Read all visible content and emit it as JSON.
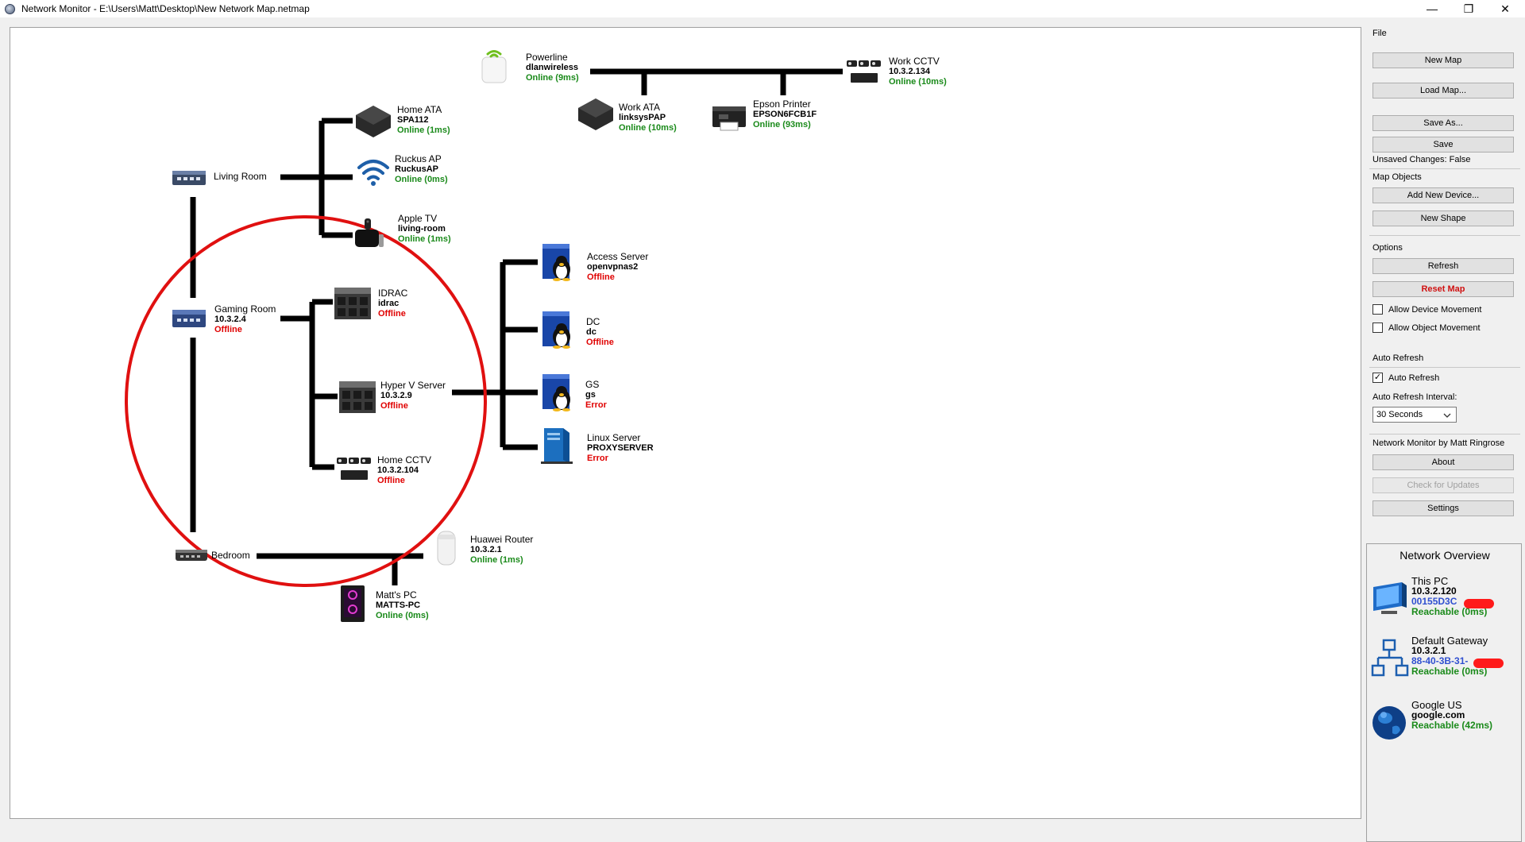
{
  "window": {
    "title": "Network Monitor - E:\\Users\\Matt\\Desktop\\New Network Map.netmap",
    "minimize": "—",
    "maximize": "❐",
    "close": "✕"
  },
  "devices": {
    "living_room": {
      "name": "Living Room",
      "icon": "switch-icon"
    },
    "gaming_room": {
      "name": "Gaming Room",
      "host": "10.3.2.4",
      "status": "Offline",
      "icon": "switch-icon"
    },
    "bedroom": {
      "name": "Bedroom",
      "icon": "switch-icon"
    },
    "home_ata": {
      "name": "Home ATA",
      "host": "SPA112",
      "status": "Online (1ms)",
      "icon": "ata-icon"
    },
    "ruckus_ap": {
      "name": "Ruckus AP",
      "host": "RuckusAP",
      "status": "Online (0ms)",
      "icon": "wifi-icon"
    },
    "apple_tv": {
      "name": "Apple TV",
      "host": "living-room",
      "status": "Online (1ms)",
      "icon": "apple-tv-icon"
    },
    "idrac": {
      "name": "IDRAC",
      "host": "idrac",
      "status": "Offline",
      "icon": "server-icon"
    },
    "hyperv": {
      "name": "Hyper V Server",
      "host": "10.3.2.9",
      "status": "Offline",
      "icon": "server-icon"
    },
    "home_cctv": {
      "name": "Home CCTV",
      "host": "10.3.2.104",
      "status": "Offline",
      "icon": "cctv-icon"
    },
    "access_server": {
      "name": "Access Server",
      "host": "openvpnas2",
      "status": "Offline",
      "icon": "linux-icon"
    },
    "dc": {
      "name": "DC",
      "host": "dc",
      "status": "Offline",
      "icon": "linux-icon"
    },
    "gs": {
      "name": "GS",
      "host": "gs",
      "status": "Error",
      "icon": "linux-icon"
    },
    "linux_server": {
      "name": "Linux Server",
      "host": "PROXYSERVER",
      "status": "Error",
      "icon": "pc-tower-icon"
    },
    "powerline": {
      "name": "Powerline",
      "host": "dlanwireless",
      "status": "Online (9ms)",
      "icon": "powerline-icon"
    },
    "work_ata": {
      "name": "Work ATA",
      "host": "linksysPAP",
      "status": "Online (10ms)",
      "icon": "ata-icon"
    },
    "epson": {
      "name": "Epson Printer",
      "host": "EPSON6FCB1F",
      "status": "Online (93ms)",
      "icon": "printer-icon"
    },
    "work_cctv": {
      "name": "Work CCTV",
      "host": "10.3.2.134",
      "status": "Online (10ms)",
      "icon": "cctv-icon"
    },
    "huawei": {
      "name": "Huawei Router",
      "host": "10.3.2.1",
      "status": "Online (1ms)",
      "icon": "router-icon"
    },
    "matts_pc": {
      "name": "Matt's PC",
      "host": "MATTS-PC",
      "status": "Online (0ms)",
      "icon": "gaming-pc-icon"
    }
  },
  "panel": {
    "file": {
      "label": "File",
      "new_map": "New Map",
      "load_map": "Load Map...",
      "save_as": "Save As...",
      "save": "Save",
      "unsaved": "Unsaved Changes: False"
    },
    "map_objects": {
      "label": "Map Objects",
      "add_device": "Add New Device...",
      "new_shape": "New Shape"
    },
    "options": {
      "label": "Options",
      "refresh": "Refresh",
      "reset_map": "Reset Map",
      "allow_device_movement": "Allow Device Movement",
      "allow_object_movement": "Allow Object Movement"
    },
    "auto_refresh": {
      "label": "Auto Refresh",
      "checkbox": "Auto Refresh",
      "interval_label": "Auto Refresh Interval:",
      "interval_value": "30 Seconds"
    },
    "about_group": {
      "label": "Network Monitor by Matt Ringrose",
      "about": "About",
      "check_updates": "Check for Updates",
      "settings": "Settings"
    },
    "overview": {
      "title": "Network Overview",
      "this_pc": {
        "name": "This PC",
        "ip": "10.3.2.120",
        "mac": "00155D3C",
        "status": "Reachable (0ms)"
      },
      "gateway": {
        "name": "Default Gateway",
        "ip": "10.3.2.1",
        "mac": "88-40-3B-31-",
        "status": "Reachable (0ms)"
      },
      "google": {
        "name": "Google US",
        "host": "google.com",
        "status": "Reachable (42ms)"
      }
    }
  },
  "colors": {
    "online": "#1a8a1a",
    "offline": "#e00000",
    "link_line": "#000000",
    "annotation_circle": "#e01010",
    "mac_blue": "#3050d0"
  }
}
